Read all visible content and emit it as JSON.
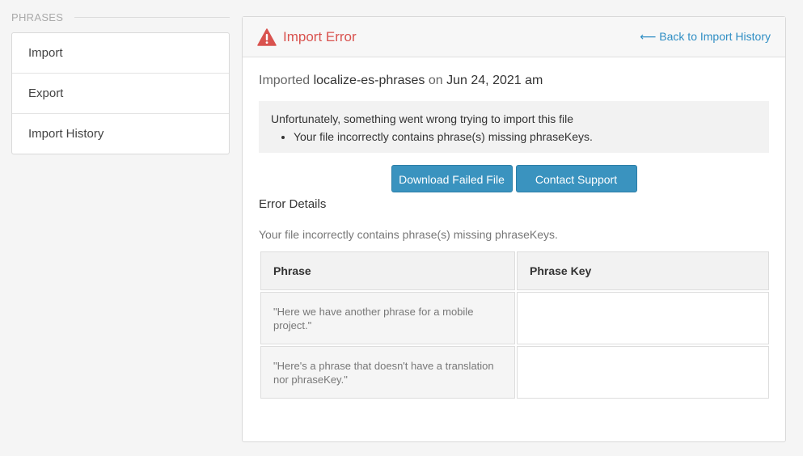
{
  "sidebar": {
    "section_title": "PHRASES",
    "items": [
      {
        "label": "Import"
      },
      {
        "label": "Export"
      },
      {
        "label": "Import History"
      }
    ]
  },
  "panel": {
    "title": "Import Error",
    "title_icon": "warning-triangle-icon",
    "back_link": "⟵ Back to Import History",
    "imported_prefix": "Imported",
    "file_name": "localize-es-phrases",
    "imported_on": "on",
    "date": "Jun 24, 2021 am",
    "error_box": {
      "message": "Unfortunately, something went wrong trying to import this file",
      "bullets": [
        "Your file incorrectly contains phrase(s) missing phraseKeys."
      ]
    },
    "buttons": {
      "download": "Download Failed File",
      "contact": "Contact Support"
    },
    "details_title": "Error Details",
    "details_message": "Your file incorrectly contains phrase(s) missing phraseKeys.",
    "table": {
      "headers": [
        "Phrase",
        "Phrase Key"
      ],
      "rows": [
        {
          "phrase": "\"Here we have another phrase for a mobile project.\"",
          "key": ""
        },
        {
          "phrase": "\"Here's a phrase that doesn't have a translation nor phraseKey.\"",
          "key": ""
        }
      ]
    }
  },
  "colors": {
    "error": "#d9534f",
    "link": "#2f8ec4",
    "button": "#3a93bf"
  }
}
